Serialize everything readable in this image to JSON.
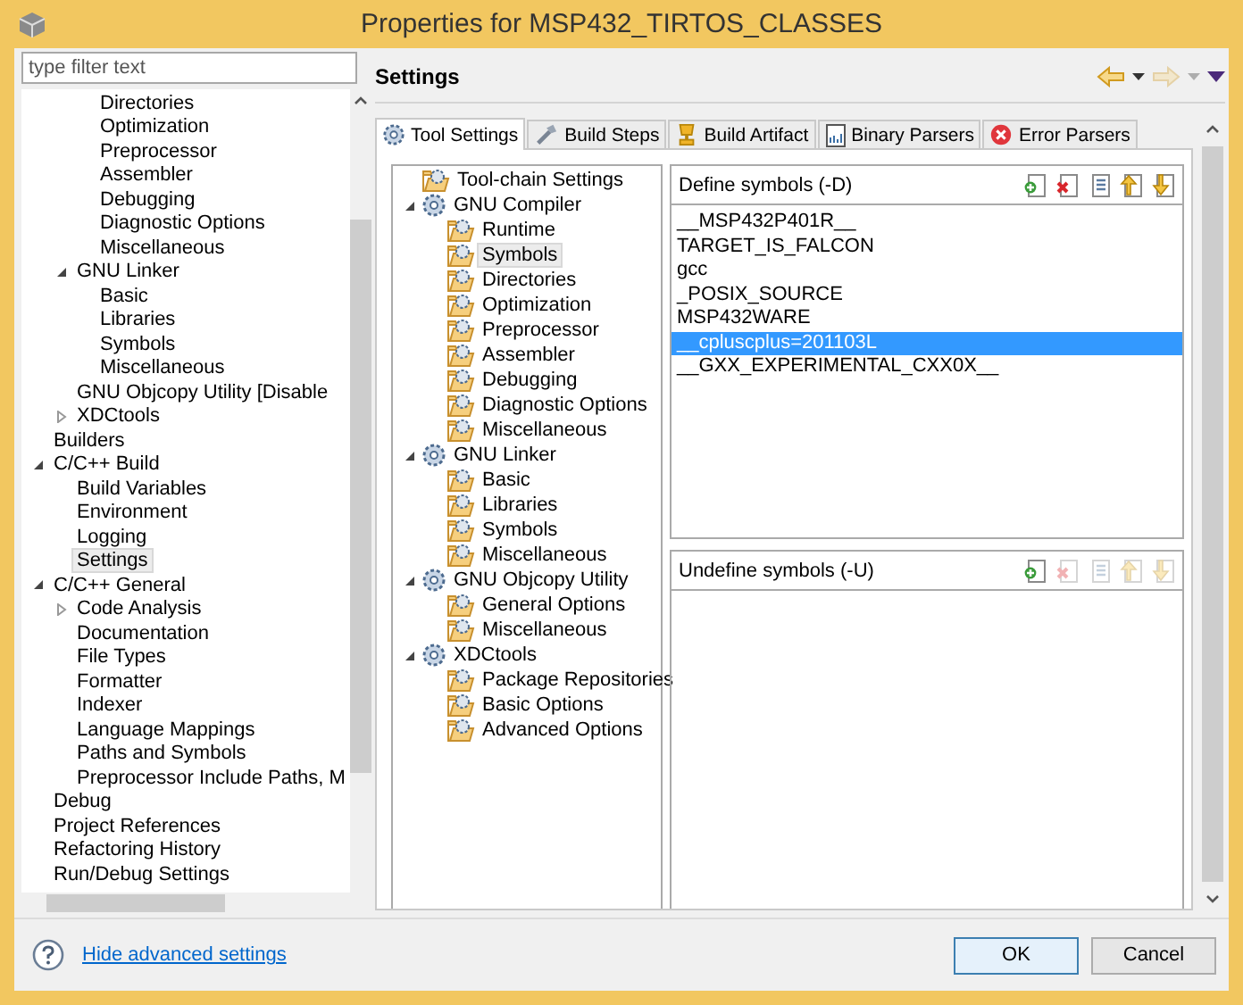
{
  "window": {
    "title": "Properties for MSP432_TIRTOS_CLASSES"
  },
  "filter": {
    "placeholder": "type filter text"
  },
  "nav_tree": [
    {
      "children": [
        {
          "children": [
            {
              "label": "Directories",
              "selected": false
            },
            {
              "label": "Optimization",
              "selected": false
            },
            {
              "label": "Preprocessor",
              "selected": false
            },
            {
              "label": "Assembler",
              "selected": false
            },
            {
              "label": "Debugging",
              "selected": false
            },
            {
              "label": "Diagnostic Options",
              "selected": false
            },
            {
              "label": "Miscellaneous",
              "selected": false
            }
          ]
        },
        {
          "label": "GNU Linker",
          "expanded": true,
          "selected": false,
          "children": [
            {
              "label": "Basic",
              "selected": false
            },
            {
              "label": "Libraries",
              "selected": false
            },
            {
              "label": "Symbols",
              "selected": false
            },
            {
              "label": "Miscellaneous",
              "selected": false
            }
          ]
        },
        {
          "label": "GNU Objcopy Utility  [Disable",
          "selected": false
        },
        {
          "label": "XDCtools",
          "expanded": false,
          "selected": false
        }
      ]
    },
    {
      "label": "Builders",
      "selected": false
    },
    {
      "label": "C/C++ Build",
      "expanded": true,
      "selected": false,
      "children": [
        {
          "label": "Build Variables",
          "selected": false
        },
        {
          "label": "Environment",
          "selected": false
        },
        {
          "label": "Logging",
          "selected": false
        },
        {
          "label": "Settings",
          "selected": true
        }
      ]
    },
    {
      "label": "C/C++ General",
      "expanded": true,
      "selected": false,
      "children": [
        {
          "label": "Code Analysis",
          "expanded": false,
          "selected": false
        },
        {
          "label": "Documentation",
          "selected": false
        },
        {
          "label": "File Types",
          "selected": false
        },
        {
          "label": "Formatter",
          "selected": false
        },
        {
          "label": "Indexer",
          "selected": false
        },
        {
          "label": "Language Mappings",
          "selected": false
        },
        {
          "label": "Paths and Symbols",
          "selected": false
        },
        {
          "label": "Preprocessor Include Paths, M",
          "selected": false
        }
      ]
    },
    {
      "label": "Debug",
      "selected": false
    },
    {
      "label": "Project References",
      "selected": false
    },
    {
      "label": "Refactoring History",
      "selected": false
    },
    {
      "label": "Run/Debug Settings",
      "selected": false
    }
  ],
  "page": {
    "title": "Settings",
    "back_disabled": false,
    "forward_disabled": true
  },
  "tabs": [
    {
      "label": "Tool Settings",
      "kind": "gear",
      "selected": true
    },
    {
      "label": "Build Steps",
      "kind": "tool",
      "selected": false
    },
    {
      "label": "Build Artifact",
      "kind": "trophy",
      "selected": false
    },
    {
      "label": "Binary Parsers",
      "kind": "document",
      "selected": false
    },
    {
      "label": "Error Parsers",
      "kind": "error",
      "selected": false
    }
  ],
  "tool_tree": [
    {
      "label": "Tool-chain Settings",
      "kind": "page",
      "selected": false
    },
    {
      "label": "GNU Compiler",
      "kind": "group",
      "expanded": true,
      "selected": false,
      "children": [
        {
          "label": "Runtime",
          "kind": "page",
          "selected": false
        },
        {
          "label": "Symbols",
          "kind": "page",
          "selected": true
        },
        {
          "label": "Directories",
          "kind": "page",
          "selected": false
        },
        {
          "label": "Optimization",
          "kind": "page",
          "selected": false
        },
        {
          "label": "Preprocessor",
          "kind": "page",
          "selected": false
        },
        {
          "label": "Assembler",
          "kind": "page",
          "selected": false
        },
        {
          "label": "Debugging",
          "kind": "page",
          "selected": false
        },
        {
          "label": "Diagnostic Options",
          "kind": "page",
          "selected": false
        },
        {
          "label": "Miscellaneous",
          "kind": "page",
          "selected": false
        }
      ]
    },
    {
      "label": "GNU Linker",
      "kind": "group",
      "expanded": true,
      "selected": false,
      "children": [
        {
          "label": "Basic",
          "kind": "page",
          "selected": false
        },
        {
          "label": "Libraries",
          "kind": "page",
          "selected": false
        },
        {
          "label": "Symbols",
          "kind": "page",
          "selected": false
        },
        {
          "label": "Miscellaneous",
          "kind": "page",
          "selected": false
        }
      ]
    },
    {
      "label": "GNU Objcopy Utility",
      "kind": "group",
      "expanded": true,
      "selected": false,
      "children": [
        {
          "label": "General Options",
          "kind": "page",
          "selected": false
        },
        {
          "label": "Miscellaneous",
          "kind": "page",
          "selected": false
        }
      ]
    },
    {
      "label": "XDCtools",
      "kind": "group",
      "expanded": true,
      "selected": false,
      "children": [
        {
          "label": "Package Repositories",
          "kind": "page",
          "selected": false
        },
        {
          "label": "Basic Options",
          "kind": "page",
          "selected": false
        },
        {
          "label": "Advanced Options",
          "kind": "page",
          "selected": false
        }
      ]
    }
  ],
  "define_symbols": {
    "title": "Define symbols (-D)",
    "tools": [
      {
        "kind": "add",
        "disabled": false
      },
      {
        "kind": "delete",
        "disabled": false
      },
      {
        "kind": "edit",
        "disabled": false
      },
      {
        "kind": "up",
        "disabled": false
      },
      {
        "kind": "down",
        "disabled": false
      }
    ],
    "items": [
      {
        "label": "__MSP432P401R__",
        "selected": false
      },
      {
        "label": "TARGET_IS_FALCON",
        "selected": false
      },
      {
        "label": "gcc",
        "selected": false
      },
      {
        "label": "_POSIX_SOURCE",
        "selected": false
      },
      {
        "label": "MSP432WARE",
        "selected": false
      },
      {
        "label": "__cpluscplus=201103L",
        "selected": true
      },
      {
        "label": "__GXX_EXPERIMENTAL_CXX0X__",
        "selected": false
      }
    ]
  },
  "undefine_symbols": {
    "title": "Undefine symbols (-U)",
    "tools": [
      {
        "kind": "add",
        "disabled": false
      },
      {
        "kind": "delete",
        "disabled": true
      },
      {
        "kind": "edit",
        "disabled": true
      },
      {
        "kind": "up",
        "disabled": true
      },
      {
        "kind": "down",
        "disabled": true
      }
    ]
  },
  "footer": {
    "link": "Hide advanced settings",
    "buttons": [
      {
        "label": "OK",
        "default": true
      },
      {
        "label": "Cancel",
        "default": false
      }
    ]
  }
}
